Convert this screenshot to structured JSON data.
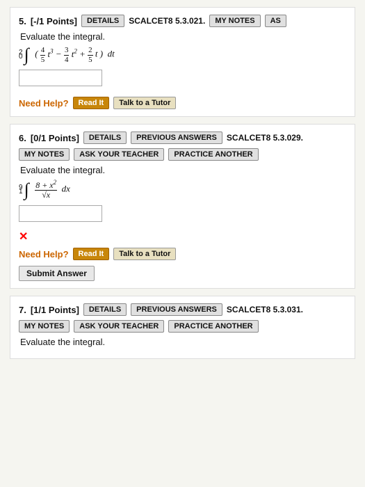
{
  "problems": [
    {
      "id": "problem-5",
      "number": "5.",
      "points": "[-/1 Points]",
      "details_label": "DETAILS",
      "scalcet_label": "SCALCET8 5.3.021.",
      "notes_label": "MY NOTES",
      "ask_label": "AS",
      "instruction": "Evaluate the integral.",
      "integral_display": "∫₀² (4/5 t³ − 3/4 t² + 2/5 t) dt",
      "need_help": "Need Help?",
      "read_it": "Read It",
      "talk_tutor": "Talk to a Tutor",
      "has_error": false,
      "show_submit": false,
      "show_previous": false,
      "show_ask": false,
      "show_practice": false
    },
    {
      "id": "problem-6",
      "number": "6.",
      "points": "[0/1 Points]",
      "details_label": "DETAILS",
      "prev_label": "PREVIOUS ANSWERS",
      "scalcet_label": "SCALCET8 5.3.029.",
      "notes_label": "MY NOTES",
      "ask_label": "ASK YOUR TEACHER",
      "practice_label": "PRACTICE ANOTHER",
      "instruction": "Evaluate the integral.",
      "integral_upper": "9",
      "integral_lower": "1",
      "need_help": "Need Help?",
      "read_it": "Read It",
      "talk_tutor": "Talk to a Tutor",
      "has_error": true,
      "show_submit": true,
      "submit_label": "Submit Answer"
    },
    {
      "id": "problem-7",
      "number": "7.",
      "points": "[1/1 Points]",
      "details_label": "DETAILS",
      "prev_label": "PREVIOUS ANSWERS",
      "scalcet_label": "SCALCET8 5.3.031.",
      "notes_label": "MY NOTES",
      "ask_label": "ASK YOUR TEACHER",
      "practice_label": "PRACTICE ANOTHER",
      "instruction": "Evaluate the integral."
    }
  ]
}
